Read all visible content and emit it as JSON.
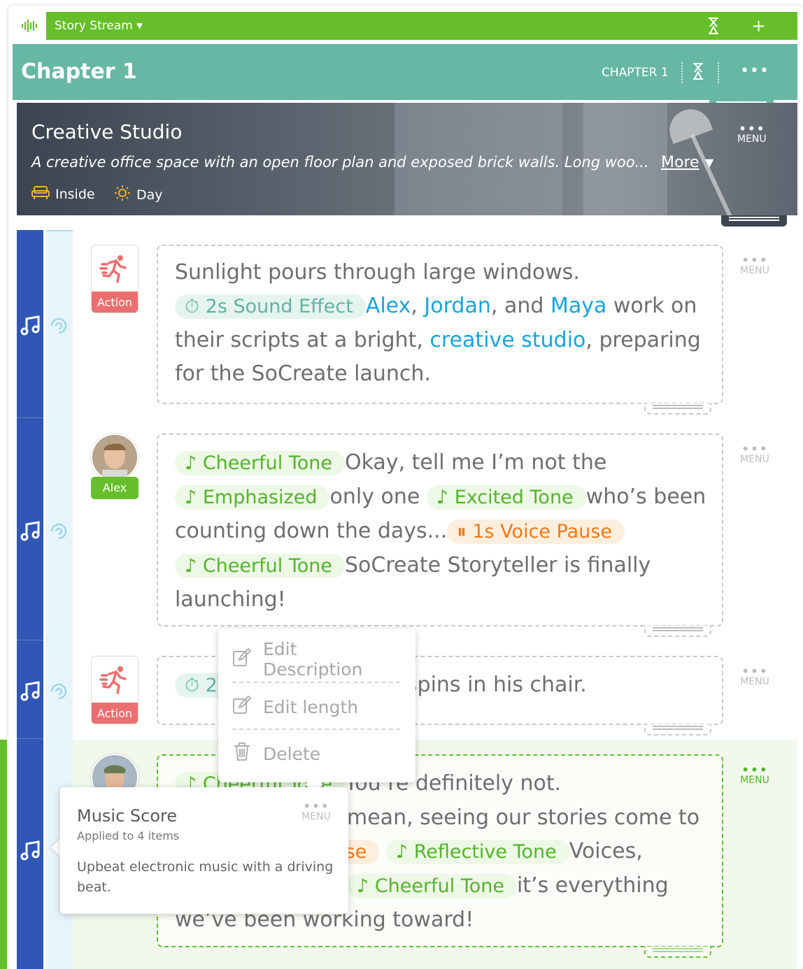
{
  "stream": {
    "title": "Story Stream ▾",
    "add_label": "+"
  },
  "chapter": {
    "title": "Chapter 1",
    "label": "CHAPTER 1",
    "menu": "•••"
  },
  "scene": {
    "title": "Creative Studio",
    "description": "A creative office space with an open floor plan and exposed brick walls. Long woo...",
    "more_label": "More",
    "location": "Inside",
    "time": "Day",
    "menu_dots": "•••",
    "menu_label": "MENU"
  },
  "menu_dots": "•••",
  "menu_label": "MENU",
  "rows": [
    {
      "badge": "Action",
      "chip_sfx": "2s Sound Effect",
      "ent1": "Alex",
      "sep1": ", ",
      "ent2": "Jordan",
      "sep2": ", and ",
      "ent3": "Maya",
      "text1": " work on their scripts at a bright, ",
      "ent4": "creative studio",
      "text2": ", preparing for the SoCreate launch."
    },
    {
      "character": "Alex",
      "chip1": "Cheerful Tone",
      "text1": "Okay, tell me I’m not the",
      "chip2": "Emphasized",
      "text2": "only one",
      "chip3": "Excited Tone",
      "text3": "who’s been counting down the days...",
      "chip4": "1s Voice Pause",
      "chip5": "Cheerful Tone",
      "text4": "SoCreate Storyteller is finally launching!"
    },
    {
      "badge": "Action",
      "chip_sfx": "2s",
      "text1": "spins in his chair."
    },
    {
      "chip1": "Cheerful Tone",
      "text1": "You’re definitely not.",
      "text2": "mean, seeing our stories come to",
      "chip2": "ause",
      "chip3": "Reflective Tone",
      "text3": "Voices,",
      "chip4": "Cheerful Tone",
      "text4": "it’s everything",
      "text5": "we’ve been working toward!"
    }
  ],
  "popup": {
    "items": [
      "Edit Description",
      "Edit length",
      "Delete"
    ]
  },
  "tooltip": {
    "title": "Music Score",
    "subtitle": "Applied to 4 items",
    "body": "Upbeat electronic music with a driving beat."
  },
  "colors": {
    "brand_green": "#66bf2a",
    "chapter_teal": "#66b7a3",
    "score_blue": "#3057b5",
    "action_red": "#ec6f6f",
    "entity_blue": "#1aa3d9",
    "pause_orange": "#f07a1a"
  }
}
